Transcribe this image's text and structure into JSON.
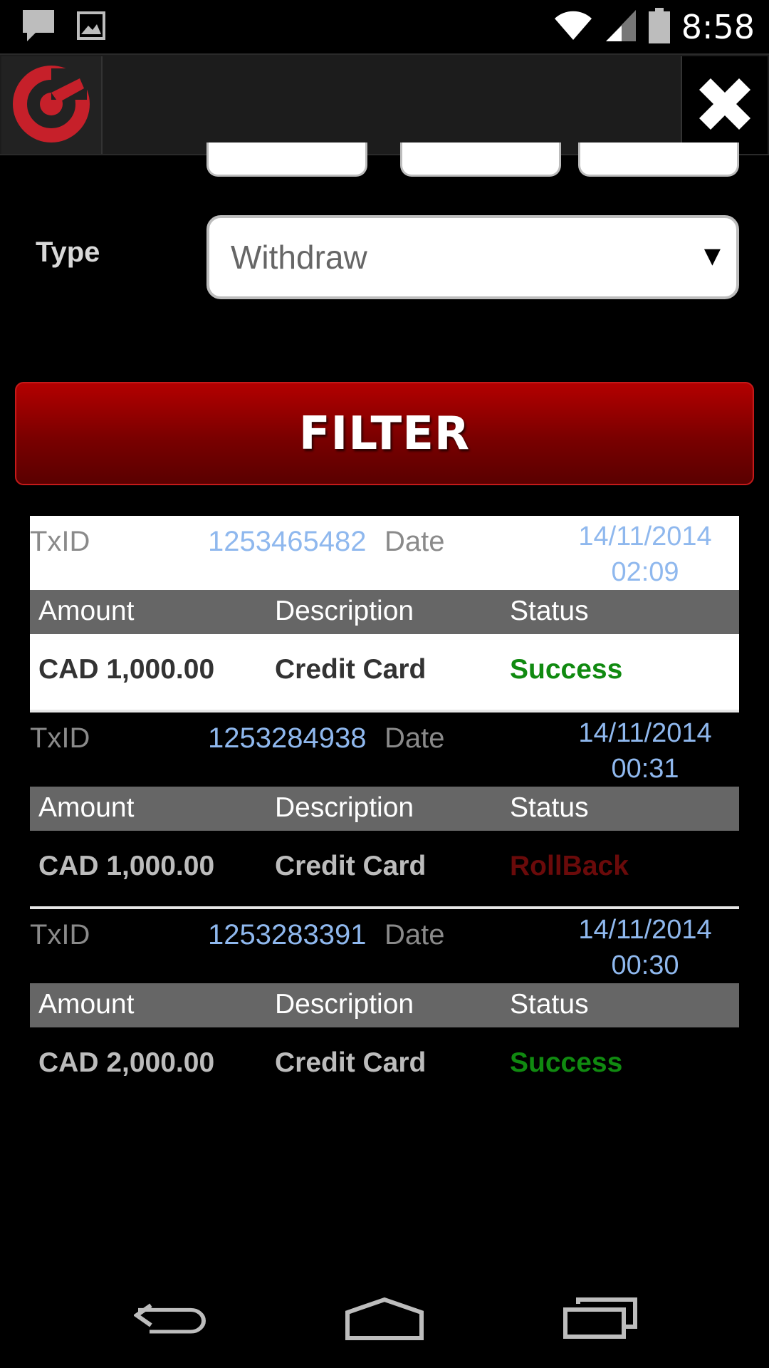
{
  "status_bar": {
    "time": "8:58",
    "icons": [
      "chat-icon",
      "image-icon",
      "wifi-icon",
      "signal-icon",
      "battery-icon"
    ]
  },
  "header": {
    "logo_icon": "logo-icon",
    "close_icon": "close-icon"
  },
  "filter": {
    "type_label": "Type",
    "type_value": "Withdraw",
    "button_label": "FILTER"
  },
  "transactions": [
    {
      "txid_label": "TxID",
      "txid": "1253465482",
      "date_label": "Date",
      "date": "14/11/2014",
      "time": "02:09",
      "col_amount": "Amount",
      "col_description": "Description",
      "col_status": "Status",
      "amount": "CAD 1,000.00",
      "description": "Credit Card",
      "status": "Success"
    },
    {
      "txid_label": "TxID",
      "txid": "1253284938",
      "date_label": "Date",
      "date": "14/11/2014",
      "time": "00:31",
      "col_amount": "Amount",
      "col_description": "Description",
      "col_status": "Status",
      "amount": "CAD 1,000.00",
      "description": "Credit Card",
      "status": "RollBack"
    },
    {
      "txid_label": "TxID",
      "txid": "1253283391",
      "date_label": "Date",
      "date": "14/11/2014",
      "time": "00:30",
      "col_amount": "Amount",
      "col_description": "Description",
      "col_status": "Status",
      "amount": "CAD 2,000.00",
      "description": "Credit Card",
      "status": "Success"
    }
  ],
  "nav_bar": {
    "icons": [
      "back-icon",
      "home-icon",
      "recents-icon"
    ]
  },
  "colors": {
    "accent": "#9e0000",
    "success": "#108a10",
    "rollback": "#6a0a0a",
    "link": "#8fb8ee"
  }
}
